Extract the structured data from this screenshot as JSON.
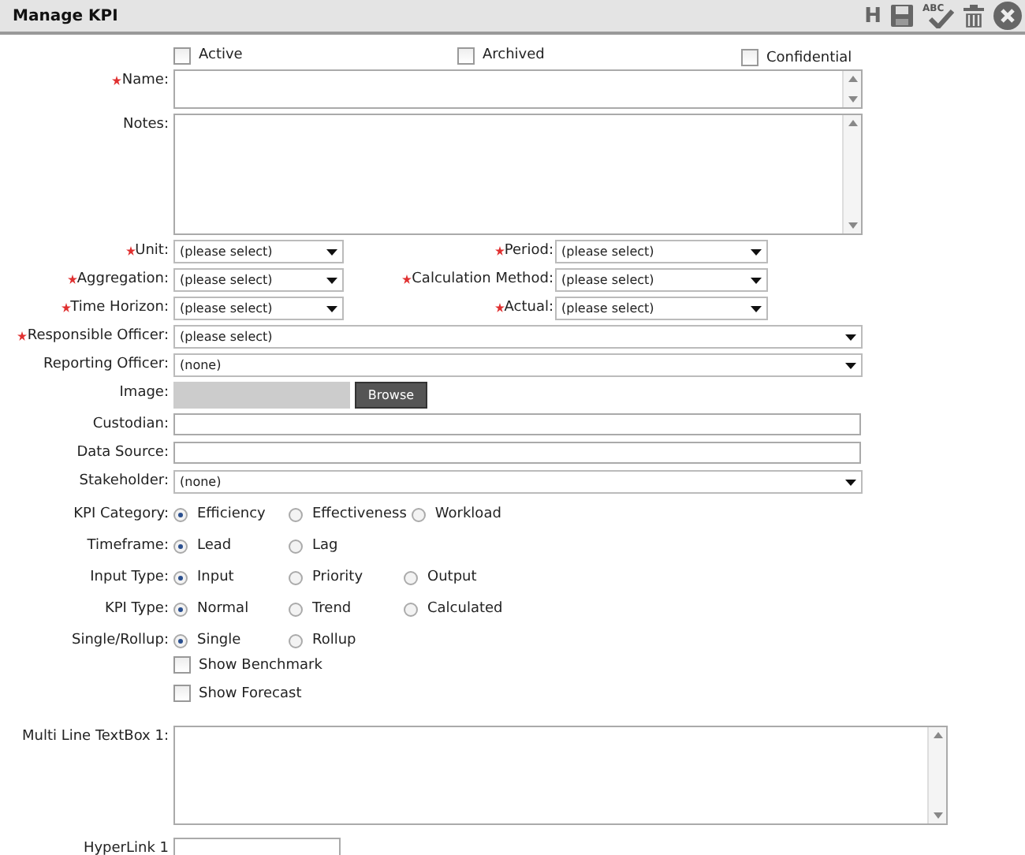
{
  "window": {
    "title": "Manage KPI"
  },
  "toolbar": [
    {
      "kind": "letter",
      "text": "H"
    },
    {
      "kind": "save"
    },
    {
      "kind": "spellcheck",
      "text": "ABC"
    },
    {
      "kind": "delete"
    },
    {
      "kind": "close"
    }
  ],
  "flags": [
    {
      "label": "Active",
      "checked": false
    },
    {
      "label": "Archived",
      "checked": false
    },
    {
      "label": "Confidential",
      "checked": false
    }
  ],
  "rows": [
    {
      "kind": "textarea-short",
      "label": "Name:",
      "required": true
    },
    {
      "kind": "textarea-tall",
      "label": "Notes:",
      "required": false
    },
    {
      "kind": "select-pair",
      "items": [
        {
          "label": "Unit:",
          "required": true,
          "value": "(please select)"
        },
        {
          "label": "Period:",
          "required": true,
          "value": "(please select)"
        }
      ]
    },
    {
      "kind": "select-pair",
      "items": [
        {
          "label": "Aggregation:",
          "required": true,
          "value": "(please select)"
        },
        {
          "label": "Calculation Method:",
          "required": true,
          "value": "(please select)"
        }
      ]
    },
    {
      "kind": "select-pair",
      "items": [
        {
          "label": "Time Horizon:",
          "required": true,
          "value": "(please select)"
        },
        {
          "label": "Actual:",
          "required": true,
          "value": "(please select)"
        }
      ]
    },
    {
      "kind": "select",
      "label": "Responsible Officer:",
      "required": true,
      "value": "(please select)"
    },
    {
      "kind": "select",
      "label": "Reporting Officer:",
      "required": false,
      "value": "(none)"
    },
    {
      "kind": "file",
      "label": "Image:",
      "required": false,
      "button": "Browse"
    },
    {
      "kind": "text",
      "label": "Custodian:",
      "required": false
    },
    {
      "kind": "text",
      "label": "Data Source:",
      "required": false
    },
    {
      "kind": "select",
      "label": "Stakeholder:",
      "required": false,
      "value": "(none)"
    },
    {
      "kind": "radio",
      "label": "KPI Category:",
      "options": [
        {
          "label": "Efficiency",
          "selected": true
        },
        {
          "label": "Effectiveness",
          "selected": false
        },
        {
          "label": "Workload",
          "selected": false
        }
      ]
    },
    {
      "kind": "radio",
      "label": "Timeframe:",
      "options": [
        {
          "label": "Lead",
          "selected": true
        },
        {
          "label": "Lag",
          "selected": false
        }
      ]
    },
    {
      "kind": "radio",
      "label": "Input Type:",
      "options": [
        {
          "label": "Input",
          "selected": true
        },
        {
          "label": "Priority",
          "selected": false
        },
        {
          "label": "Output",
          "selected": false
        }
      ]
    },
    {
      "kind": "radio",
      "label": "KPI Type:",
      "options": [
        {
          "label": "Normal",
          "selected": true
        },
        {
          "label": "Trend",
          "selected": false
        },
        {
          "label": "Calculated",
          "selected": false
        }
      ]
    },
    {
      "kind": "radio",
      "label": "Single/Rollup:",
      "options": [
        {
          "label": "Single",
          "selected": true
        },
        {
          "label": "Rollup",
          "selected": false
        }
      ]
    },
    {
      "kind": "checkbox",
      "label": "Show Benchmark",
      "checked": false
    },
    {
      "kind": "checkbox",
      "label": "Show Forecast",
      "checked": false
    },
    {
      "kind": "textarea-wide",
      "label": "Multi Line TextBox 1:",
      "required": false
    },
    {
      "kind": "text-short",
      "label": "HyperLink 1",
      "required": false
    }
  ]
}
